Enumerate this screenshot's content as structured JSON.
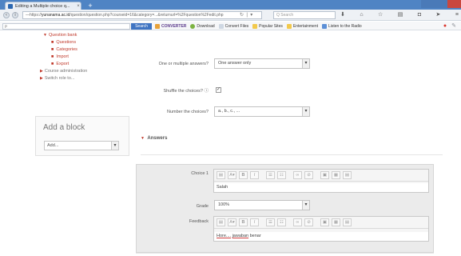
{
  "browser": {
    "tab_title": "Editing a Multiple choice q...",
    "tab_close": "×",
    "new_tab": "+",
    "url_prefix": "—https://",
    "url_domain": "yunanama.ac.id",
    "url_rest": "/question/question.php?courseid=16&category=...&returnurl=%2Fquestion%2Fedit.php",
    "search_placeholder": "Q Search",
    "toolbar_search_button": "Search",
    "bookmarks": [
      "Download",
      "Convert Files",
      "Popular Sites",
      "Entertainment",
      "Listen to the Radio"
    ],
    "converter_label": "CONVERTER"
  },
  "sidebar": {
    "items": [
      {
        "label": "Question bank",
        "level": 1,
        "expanded": true
      },
      {
        "label": "Questions",
        "level": 2
      },
      {
        "label": "Categories",
        "level": 2
      },
      {
        "label": "Import",
        "level": 2
      },
      {
        "label": "Export",
        "level": 2
      },
      {
        "label": "Course administration",
        "level": 0
      },
      {
        "label": "Switch role to...",
        "level": 0
      }
    ],
    "add_block": {
      "title": "Add a block",
      "select_value": "Add..."
    }
  },
  "form": {
    "single_label": "One or multiple answers?",
    "single_value": "One answer only",
    "shuffle_label": "Shuffle the choices?",
    "shuffle_checked": true,
    "numbering_label": "Number the choices?",
    "numbering_value": "a., b., c., ...",
    "answers_heading": "Answers",
    "choice1_label": "Choice 1",
    "choice1_text": "Salah",
    "grade_label": "Grade",
    "grade_value": "100%",
    "feedback_label": "Feedback",
    "feedback_text_a": "Hore....",
    "feedback_text_b": "jawaban",
    "feedback_text_c": "benar"
  },
  "editor_buttons": [
    "▤",
    "A▾",
    "B",
    "I",
    "☰",
    "☷",
    "🔗",
    "⊘",
    "▣",
    "▦",
    "▤"
  ]
}
